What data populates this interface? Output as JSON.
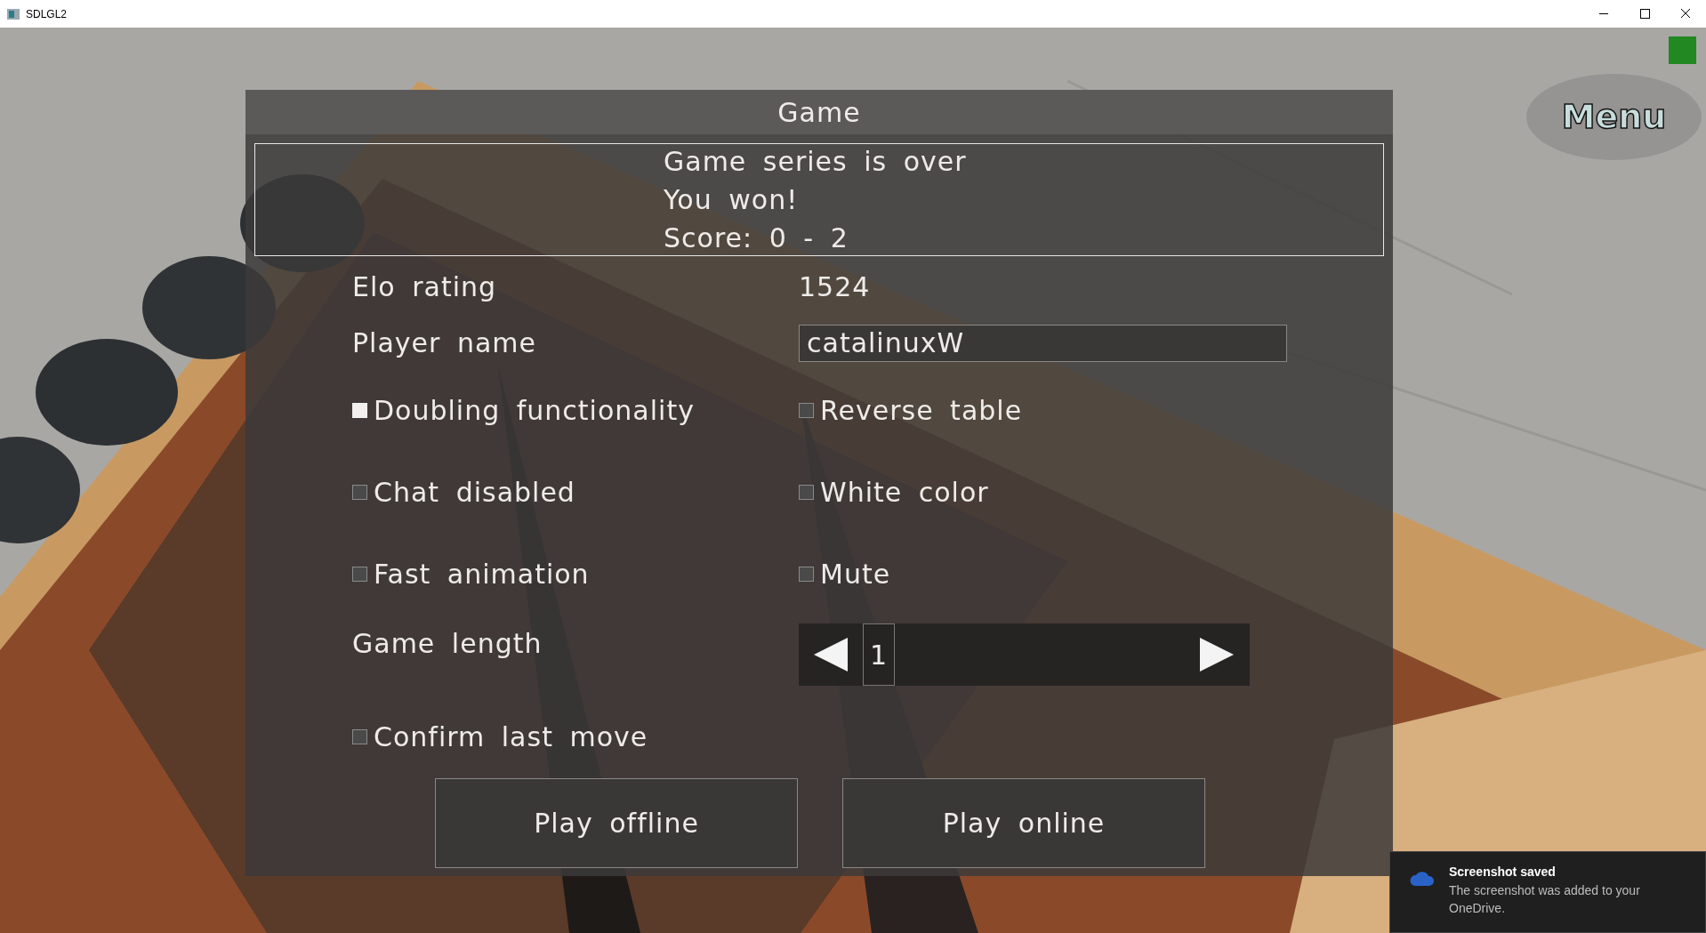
{
  "window": {
    "title": "SDLGL2"
  },
  "menu_button": {
    "label": "Menu"
  },
  "dialog": {
    "title": "Game",
    "message": [
      "Game series is over",
      "You won!",
      "Score: 0 - 2"
    ],
    "elo": {
      "label": "Elo rating",
      "value": "1524"
    },
    "player_name": {
      "label": "Player name",
      "value": "catalinuxW"
    },
    "options": [
      {
        "label": "Doubling functionality",
        "checked": true
      },
      {
        "label": "Reverse table",
        "checked": false
      },
      {
        "label": "Chat disabled",
        "checked": false
      },
      {
        "label": "White color",
        "checked": false
      },
      {
        "label": "Fast animation",
        "checked": false
      },
      {
        "label": "Mute",
        "checked": false
      }
    ],
    "game_length": {
      "label": "Game length",
      "value": "1"
    },
    "confirm_last_move": {
      "label": "Confirm last move",
      "checked": false
    },
    "buttons": [
      "Play offline",
      "Play online"
    ]
  },
  "toast": {
    "title": "Screenshot saved",
    "body": "The screenshot was added to your OneDrive."
  }
}
